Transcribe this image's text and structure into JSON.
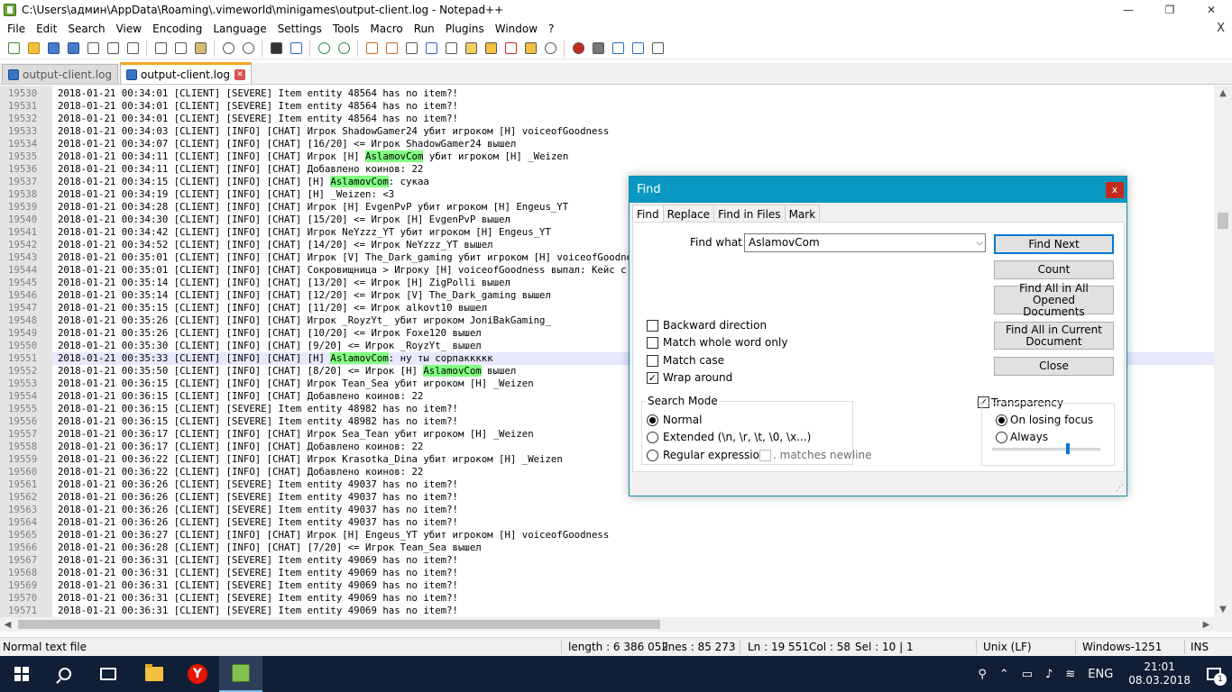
{
  "window": {
    "title": "C:\\Users\\админ\\AppData\\Roaming\\.vimeworld\\minigames\\output-client.log - Notepad++",
    "controls": {
      "minimize": "—",
      "restore": "❐",
      "close": "✕"
    }
  },
  "menu": [
    "File",
    "Edit",
    "Search",
    "View",
    "Encoding",
    "Language",
    "Settings",
    "Tools",
    "Macro",
    "Run",
    "Plugins",
    "Window",
    "?"
  ],
  "menu_close": "X",
  "tabs": [
    {
      "label": "output-client.log",
      "active": false
    },
    {
      "label": "output-client.log",
      "active": true
    }
  ],
  "editor": {
    "current_line": 19551,
    "highlight_term": "AslamovCom",
    "lines": [
      {
        "n": "19530",
        "t": "2018-01-21 00:34:01 [CLIENT] [SEVERE] Item entity 48564 has no item?!"
      },
      {
        "n": "19531",
        "t": "2018-01-21 00:34:01 [CLIENT] [SEVERE] Item entity 48564 has no item?!"
      },
      {
        "n": "19532",
        "t": "2018-01-21 00:34:01 [CLIENT] [SEVERE] Item entity 48564 has no item?!"
      },
      {
        "n": "19533",
        "t": "2018-01-21 00:34:03 [CLIENT] [INFO] [CHAT] Игрок ShadowGamer24 убит игроком [H] voiceofGoodness"
      },
      {
        "n": "19534",
        "t": "2018-01-21 00:34:07 [CLIENT] [INFO] [CHAT] [16/20] <= Игрок ShadowGamer24 вышел"
      },
      {
        "n": "19535",
        "t": "2018-01-21 00:34:11 [CLIENT] [INFO] [CHAT] Игрок [H] AslamovCom убит игроком [H] _Weizen"
      },
      {
        "n": "19536",
        "t": "2018-01-21 00:34:11 [CLIENT] [INFO] [CHAT] Добавлено коинов: 22"
      },
      {
        "n": "19537",
        "t": "2018-01-21 00:34:15 [CLIENT] [INFO] [CHAT] [H] AslamovCom: сукаа"
      },
      {
        "n": "19538",
        "t": "2018-01-21 00:34:19 [CLIENT] [INFO] [CHAT] [H] _Weizen: <3"
      },
      {
        "n": "19539",
        "t": "2018-01-21 00:34:28 [CLIENT] [INFO] [CHAT] Игрок [H] EvgenPvP убит игроком [H] Engeus_YT"
      },
      {
        "n": "19540",
        "t": "2018-01-21 00:34:30 [CLIENT] [INFO] [CHAT] [15/20] <= Игрок [H] EvgenPvP вышел"
      },
      {
        "n": "19541",
        "t": "2018-01-21 00:34:42 [CLIENT] [INFO] [CHAT] Игрок NeYzzz_YT убит игроком [H] Engeus_YT"
      },
      {
        "n": "19542",
        "t": "2018-01-21 00:34:52 [CLIENT] [INFO] [CHAT] [14/20] <= Игрок NeYzzz_YT вышел"
      },
      {
        "n": "19543",
        "t": "2018-01-21 00:35:01 [CLIENT] [INFO] [CHAT] Игрок [V] The_Dark_gaming убит игроком [H] voiceofGoodness"
      },
      {
        "n": "19544",
        "t": "2018-01-21 00:35:01 [CLIENT] [INFO] [CHAT] Сокровищница > Игроку [H] voiceofGoodness выпал: Кейс с 20 алмазами"
      },
      {
        "n": "19545",
        "t": "2018-01-21 00:35:14 [CLIENT] [INFO] [CHAT] [13/20] <= Игрок [H] ZigPolli вышел"
      },
      {
        "n": "19546",
        "t": "2018-01-21 00:35:14 [CLIENT] [INFO] [CHAT] [12/20] <= Игрок [V] The_Dark_gaming вышел"
      },
      {
        "n": "19547",
        "t": "2018-01-21 00:35:15 [CLIENT] [INFO] [CHAT] [11/20] <= Игрок alkovt10 вышел"
      },
      {
        "n": "19548",
        "t": "2018-01-21 00:35:26 [CLIENT] [INFO] [CHAT] Игрок _RoyzYt_ убит игроком JoniBakGaming_"
      },
      {
        "n": "19549",
        "t": "2018-01-21 00:35:26 [CLIENT] [INFO] [CHAT] [10/20] <= Игрок Foxe120 вышел"
      },
      {
        "n": "19550",
        "t": "2018-01-21 00:35:30 [CLIENT] [INFO] [CHAT] [9/20] <= Игрок _RoyzYt_ вышел"
      },
      {
        "n": "19551",
        "t": "2018-01-21 00:35:33 [CLIENT] [INFO] [CHAT] [H] AslamovCom: ну ты сорпаккккк"
      },
      {
        "n": "19552",
        "t": "2018-01-21 00:35:50 [CLIENT] [INFO] [CHAT] [8/20] <= Игрок [H] AslamovCom вышел"
      },
      {
        "n": "19553",
        "t": "2018-01-21 00:36:15 [CLIENT] [INFO] [CHAT] Игрок Tean_Sea убит игроком [H] _Weizen"
      },
      {
        "n": "19554",
        "t": "2018-01-21 00:36:15 [CLIENT] [INFO] [CHAT] Добавлено коинов: 22"
      },
      {
        "n": "19555",
        "t": "2018-01-21 00:36:15 [CLIENT] [SEVERE] Item entity 48982 has no item?!"
      },
      {
        "n": "19556",
        "t": "2018-01-21 00:36:15 [CLIENT] [SEVERE] Item entity 48982 has no item?!"
      },
      {
        "n": "19557",
        "t": "2018-01-21 00:36:17 [CLIENT] [INFO] [CHAT] Игрок Sea_Tean убит игроком [H] _Weizen"
      },
      {
        "n": "19558",
        "t": "2018-01-21 00:36:17 [CLIENT] [INFO] [CHAT] Добавлено коинов: 22"
      },
      {
        "n": "19559",
        "t": "2018-01-21 00:36:22 [CLIENT] [INFO] [CHAT] Игрок Krasotka_Dina убит игроком [H] _Weizen"
      },
      {
        "n": "19560",
        "t": "2018-01-21 00:36:22 [CLIENT] [INFO] [CHAT] Добавлено коинов: 22"
      },
      {
        "n": "19561",
        "t": "2018-01-21 00:36:26 [CLIENT] [SEVERE] Item entity 49037 has no item?!"
      },
      {
        "n": "19562",
        "t": "2018-01-21 00:36:26 [CLIENT] [SEVERE] Item entity 49037 has no item?!"
      },
      {
        "n": "19563",
        "t": "2018-01-21 00:36:26 [CLIENT] [SEVERE] Item entity 49037 has no item?!"
      },
      {
        "n": "19564",
        "t": "2018-01-21 00:36:26 [CLIENT] [SEVERE] Item entity 49037 has no item?!"
      },
      {
        "n": "19565",
        "t": "2018-01-21 00:36:27 [CLIENT] [INFO] [CHAT] Игрок [H] Engeus_YT убит игроком [H] voiceofGoodness"
      },
      {
        "n": "19566",
        "t": "2018-01-21 00:36:28 [CLIENT] [INFO] [CHAT] [7/20] <= Игрок Tean_Sea вышел"
      },
      {
        "n": "19567",
        "t": "2018-01-21 00:36:31 [CLIENT] [SEVERE] Item entity 49069 has no item?!"
      },
      {
        "n": "19568",
        "t": "2018-01-21 00:36:31 [CLIENT] [SEVERE] Item entity 49069 has no item?!"
      },
      {
        "n": "19569",
        "t": "2018-01-21 00:36:31 [CLIENT] [SEVERE] Item entity 49069 has no item?!"
      },
      {
        "n": "19570",
        "t": "2018-01-21 00:36:31 [CLIENT] [SEVERE] Item entity 49069 has no item?!"
      },
      {
        "n": "19571",
        "t": "2018-01-21 00:36:31 [CLIENT] [SEVERE] Item entity 49069 has no item?!"
      }
    ]
  },
  "statusbar": {
    "type": "Normal text file",
    "length": "length : 6 386 052",
    "lines": "lines : 85 273",
    "ln": "Ln : 19 551",
    "col": "Col : 58",
    "sel": "Sel : 10 | 1",
    "eol": "Unix (LF)",
    "encoding": "Windows-1251",
    "mode": "INS"
  },
  "find_dialog": {
    "title": "Find",
    "close": "x",
    "tabs": [
      "Find",
      "Replace",
      "Find in Files",
      "Mark"
    ],
    "find_what_label": "Find what :",
    "find_what_value": "AslamovCom",
    "buttons": {
      "find_next": "Find Next",
      "count": "Count",
      "find_all_opened": "Find All in All Opened Documents",
      "find_all_current": "Find All in Current Document",
      "close": "Close"
    },
    "options": {
      "backward": {
        "label": "Backward direction",
        "checked": false
      },
      "whole_word": {
        "label": "Match whole word only",
        "checked": false
      },
      "match_case": {
        "label": "Match case",
        "checked": false
      },
      "wrap_around": {
        "label": "Wrap around",
        "checked": true
      }
    },
    "search_mode": {
      "title": "Search Mode",
      "normal": "Normal",
      "extended": "Extended (\\n, \\r, \\t, \\0, \\x...)",
      "regex": "Regular expression",
      "matches_newline": ". matches newline",
      "selected": "normal"
    },
    "transparency": {
      "label": "Transparency",
      "checked": true,
      "on_losing_focus": "On losing focus",
      "always": "Always",
      "selected": "on_losing_focus",
      "level": 0.7
    }
  },
  "taskbar": {
    "lang": "ENG",
    "time": "21:01",
    "date": "08.03.2018",
    "notifications": "1"
  }
}
